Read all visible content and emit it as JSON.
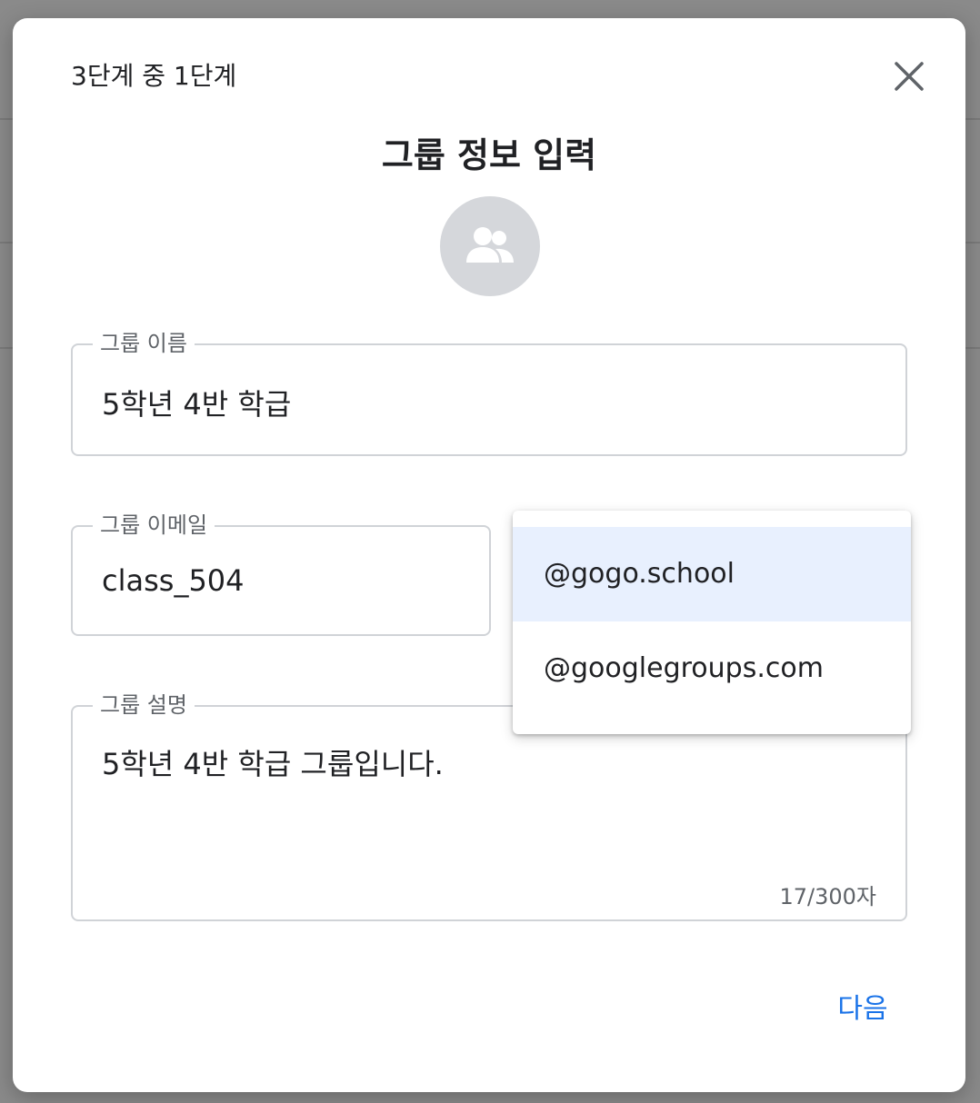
{
  "dialog": {
    "step_label": "3단계 중 1단계",
    "title": "그룹 정보 입력",
    "close_icon": "close-icon",
    "avatar_icon": "group-icon"
  },
  "form": {
    "group_name": {
      "label": "그룹 이름",
      "value": "5학년 4반 학급"
    },
    "group_email": {
      "label": "그룹 이메일",
      "value": "class_504"
    },
    "group_description": {
      "label": "그룹 설명",
      "value": "5학년 4반 학급 그룹입니다.",
      "char_count": "17/300자"
    }
  },
  "domain_dropdown": {
    "options": [
      "@gogo.school",
      "@googlegroups.com"
    ],
    "selected": "@gogo.school"
  },
  "actions": {
    "next_label": "다음"
  },
  "colors": {
    "accent": "#1a73e8",
    "selected_option_bg": "#e8f0fe",
    "avatar_bg": "#d5d7db",
    "overlay": "#7b7b7b"
  }
}
